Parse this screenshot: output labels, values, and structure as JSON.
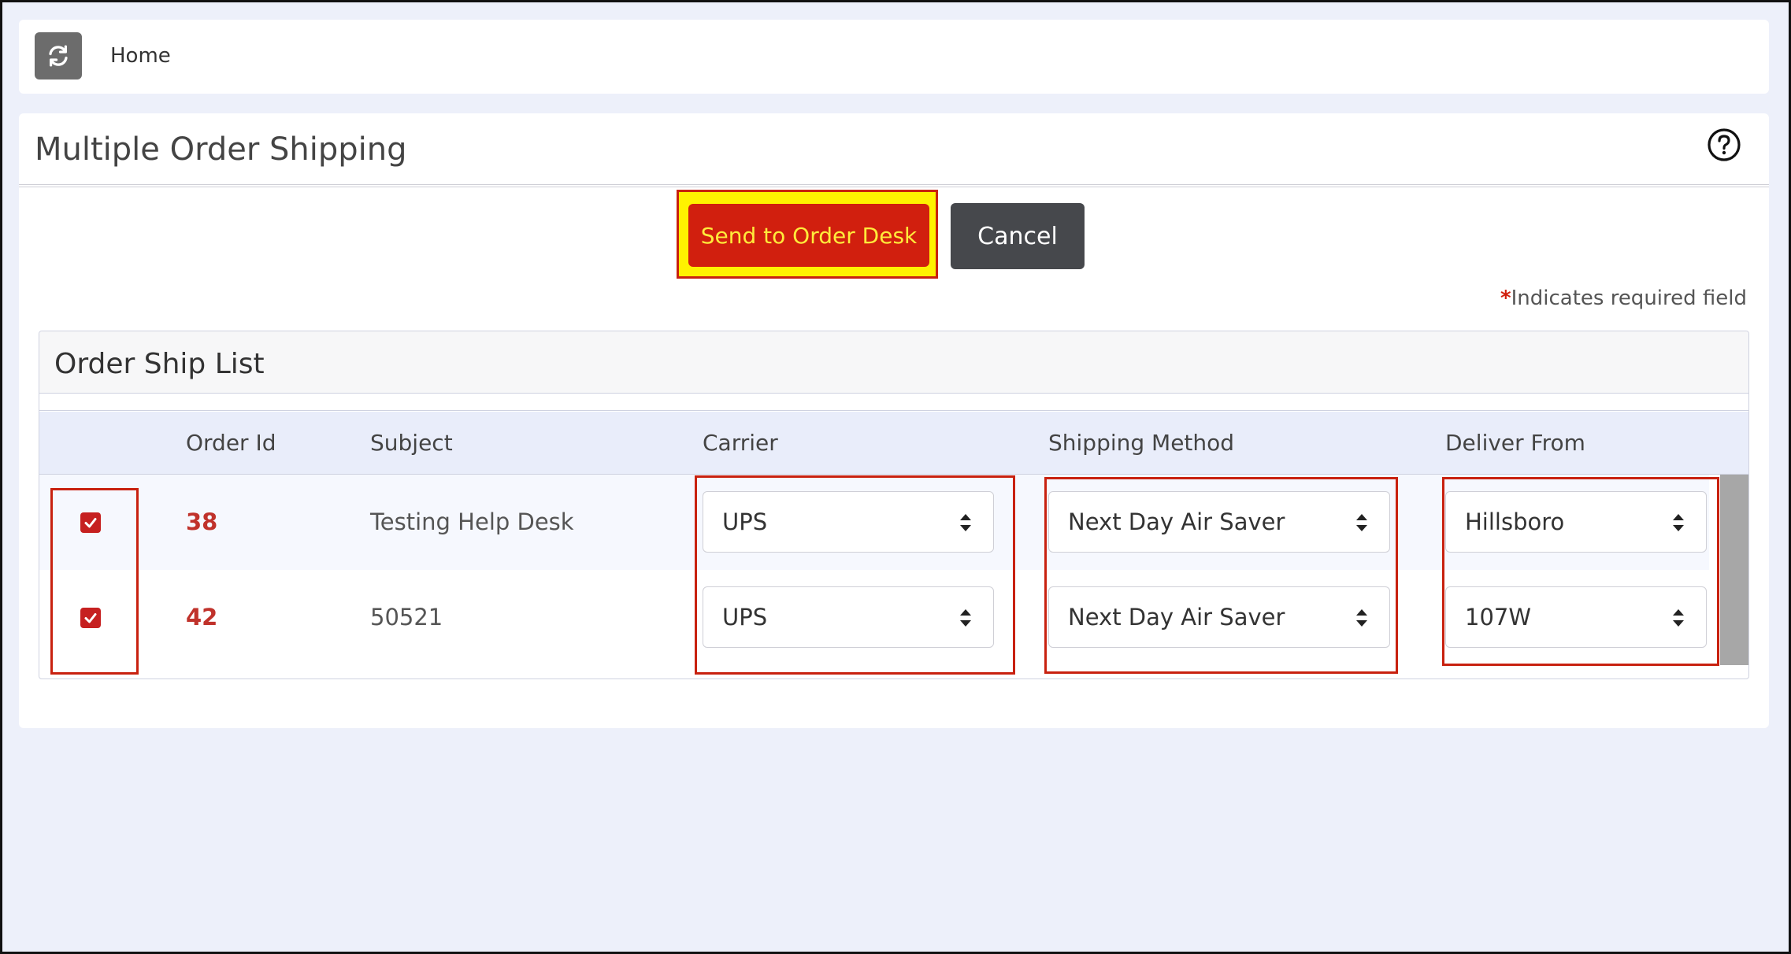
{
  "topbar": {
    "home_label": "Home"
  },
  "page": {
    "title": "Multiple Order Shipping"
  },
  "actions": {
    "send_label": "Send to Order Desk",
    "cancel_label": "Cancel"
  },
  "required_note": {
    "star": "*",
    "text": "Indicates required field"
  },
  "list": {
    "title": "Order Ship List",
    "columns": {
      "order_id": "Order Id",
      "subject": "Subject",
      "carrier": "Carrier",
      "shipping_method": "Shipping Method",
      "deliver_from": "Deliver From"
    },
    "rows": [
      {
        "checked": true,
        "order_id": "38",
        "subject": "Testing Help Desk",
        "carrier": "UPS",
        "shipping_method": "Next Day Air Saver",
        "deliver_from": "Hillsboro"
      },
      {
        "checked": true,
        "order_id": "42",
        "subject": "50521",
        "carrier": "UPS",
        "shipping_method": "Next Day Air Saver",
        "deliver_from": "107W"
      }
    ]
  },
  "colors": {
    "accent_red": "#d11f0e",
    "highlight_yellow": "#fff200",
    "order_id_red": "#c0322b",
    "background": "#edf0fa"
  },
  "icons": {
    "refresh": "refresh-icon",
    "help": "help-circle-icon",
    "checkbox": "checkmark-icon",
    "select_arrows": "select-arrows-icon"
  }
}
